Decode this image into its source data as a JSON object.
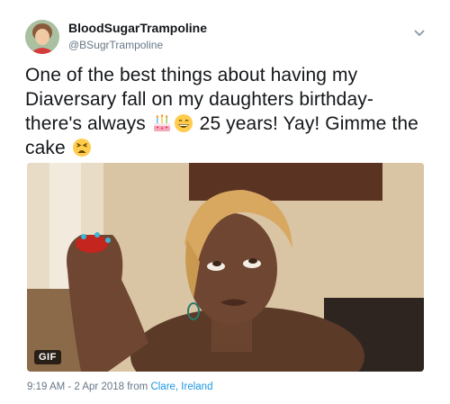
{
  "author": {
    "display_name": "BloodSugarTrampoline",
    "handle": "@BSugrTrampoline"
  },
  "tweet": {
    "text_part1": "One of the best things about having my Diaversary fall on my daughters birthday- there's always ",
    "emoji_1": "birthday-cake-emoji",
    "emoji_2": "grinning-face-emoji",
    "text_part2": " 25 years! Yay! Gimme the cake ",
    "emoji_3": "weary-face-emoji"
  },
  "media": {
    "badge": "GIF"
  },
  "meta": {
    "timestamp": "9:19 AM - 2 Apr 2018",
    "from_label": " from ",
    "location": "Clare, Ireland"
  },
  "icons": {
    "menu": "chevron-down-icon"
  },
  "colors": {
    "text": "#14171a",
    "secondary": "#657786",
    "link": "#1b95e0"
  }
}
